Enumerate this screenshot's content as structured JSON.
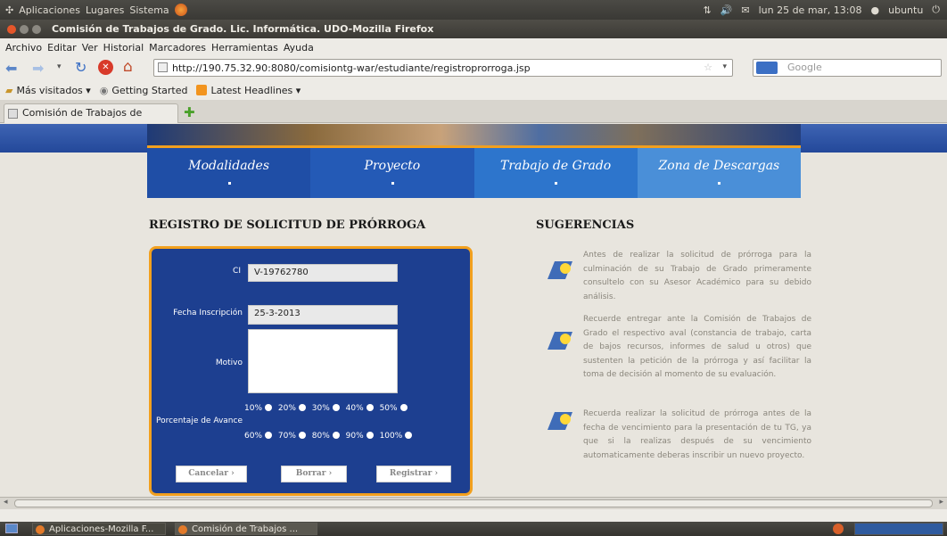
{
  "os_panel": {
    "menus": [
      "Aplicaciones",
      "Lugares",
      "Sistema"
    ],
    "clock": "lun 25 de mar, 13:08",
    "user": "ubuntu"
  },
  "window": {
    "title": "Comisión de Trabajos de Grado. Lic. Informática. UDO-Mozilla Firefox"
  },
  "menubar": {
    "items": [
      "Archivo",
      "Editar",
      "Ver",
      "Historial",
      "Marcadores",
      "Herramientas",
      "Ayuda"
    ]
  },
  "navbar": {
    "url": "http://190.75.32.90:8080/comisiontg-war/estudiante/registroprorroga.jsp",
    "search_placeholder": "Google"
  },
  "bookmarks": [
    "Más visitados ▾",
    "Getting Started",
    "Latest Headlines ▾"
  ],
  "tab": {
    "label": "Comisión de Trabajos de Grad..."
  },
  "site_nav": [
    "Modalidades",
    "Proyecto",
    "Trabajo de Grado",
    "Zona de Descargas"
  ],
  "form": {
    "heading": "REGISTRO DE SOLICITUD DE PRÓRROGA",
    "ci_label": "CI",
    "ci_value": "V-19762780",
    "fecha_label": "Fecha Inscripción",
    "fecha_value": "25-3-2013",
    "motivo_label": "Motivo",
    "avance_label": "Porcentaje de Avance",
    "options_row1": [
      "10%",
      "20%",
      "30%",
      "40%",
      "50%"
    ],
    "options_row2": [
      "60%",
      "70%",
      "80%",
      "90%",
      "100%"
    ],
    "buttons": [
      "Cancelar",
      "Borrar",
      "Registrar"
    ]
  },
  "sugerencias": {
    "heading": "SUGERENCIAS",
    "tips": [
      "Antes de realizar la solicitud de prórroga para la culminación de su Trabajo de Grado primeramente consultelo con su Asesor Académico para su debido análisis.",
      "Recuerde entregar ante la Comisión de Trabajos de Grado el respectivo aval (constancia de trabajo, carta de bajos recursos, informes de salud u otros) que sustenten la petición de la prórroga y así facilitar la toma de decisión al momento de su evaluación.",
      "Recuerda realizar la solicitud de prórroga antes de la fecha de vencimiento para la presentación de tu TG, ya que si la realizas después de su vencimiento automaticamente deberas inscribir un nuevo proyecto."
    ]
  },
  "taskbar": {
    "tasks": [
      "Aplicaciones-Mozilla F...",
      "Comisión de Trabajos ..."
    ]
  }
}
